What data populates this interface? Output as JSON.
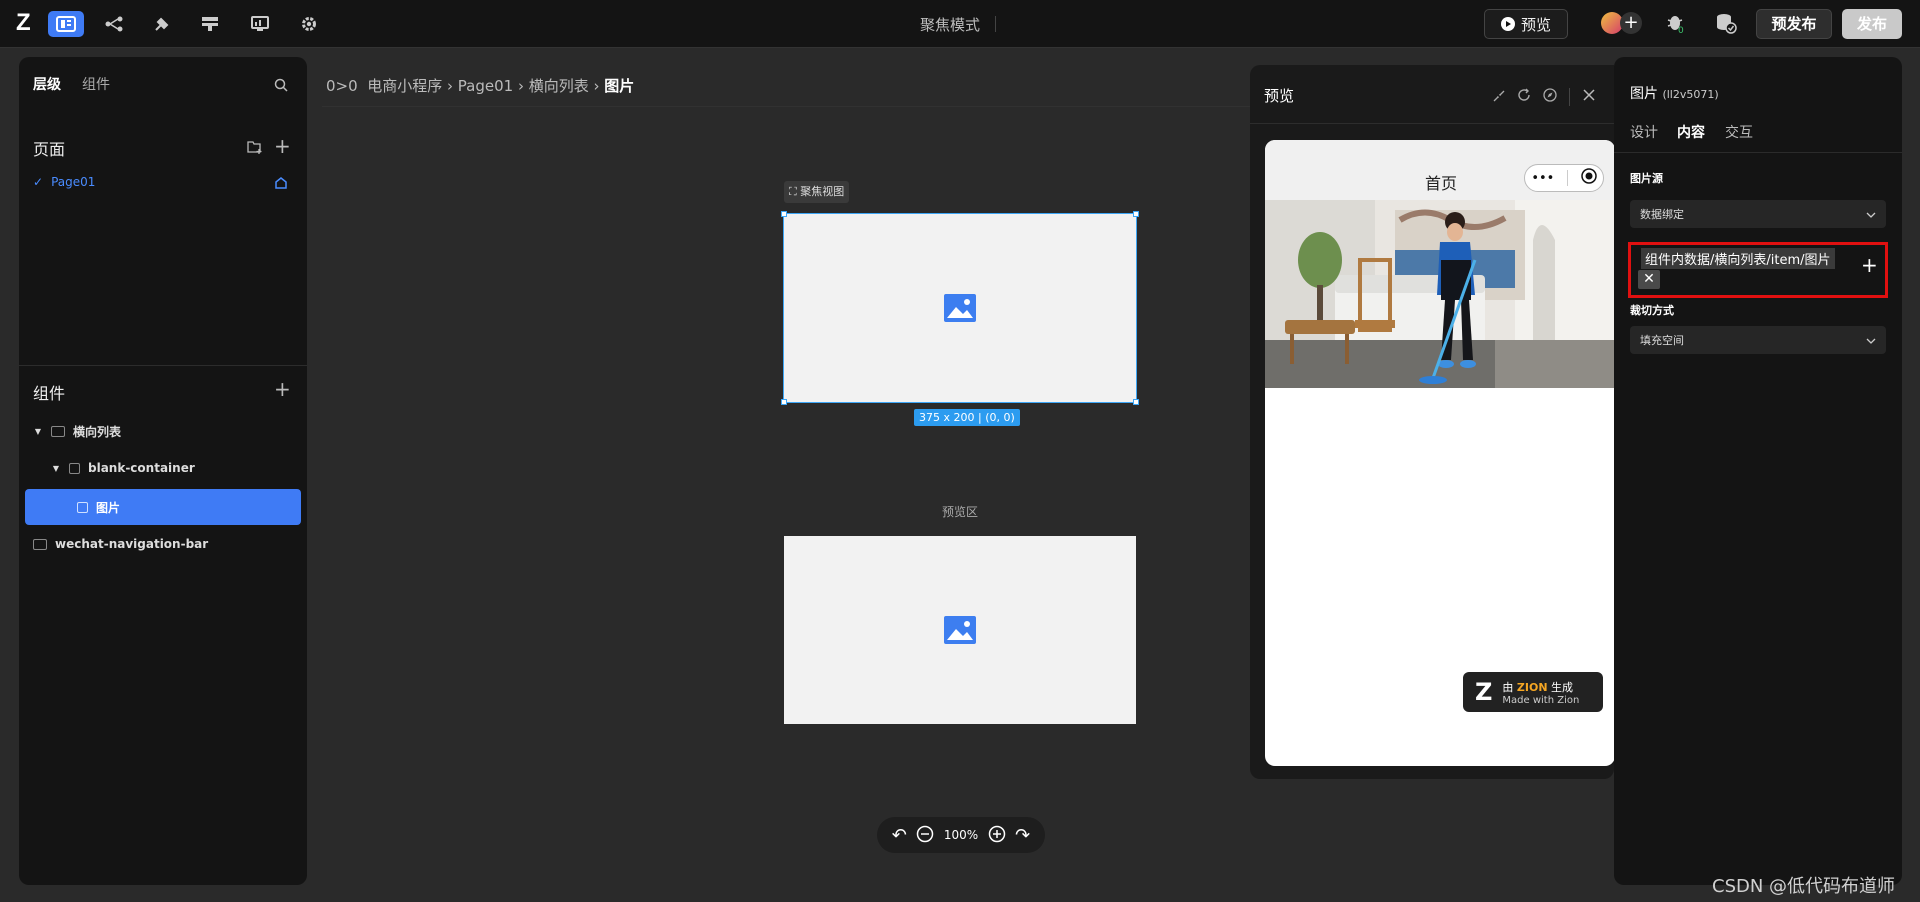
{
  "topbar": {
    "mode_title": "聚焦模式",
    "preview_label": "预览",
    "prepublish_label": "预发布",
    "publish_label": "发布"
  },
  "left_panel": {
    "tabs": [
      "层级",
      "组件"
    ],
    "pages_title": "页面",
    "pages": [
      "Page01"
    ],
    "components_title": "组件",
    "tree": [
      {
        "label": "横向列表",
        "depth": 0
      },
      {
        "label": "blank-container",
        "depth": 1
      },
      {
        "label": "图片",
        "depth": 2,
        "selected": true
      },
      {
        "label": "wechat-navigation-bar",
        "depth": 0
      }
    ]
  },
  "breadcrumb": {
    "root": "0>0",
    "items": [
      "电商小程序",
      "Page01",
      "横向列表"
    ],
    "current": "图片"
  },
  "canvas": {
    "focus_view_label": "聚焦视图",
    "size_tag": "375 x 200 | (0, 0)",
    "preview_area_label": "预览区",
    "zoom": "100%"
  },
  "preview": {
    "title": "预览",
    "phone_title": "首页",
    "capsule_dots": "•••",
    "badge_by": "由",
    "badge_brand": "ZION",
    "badge_gen": "生成",
    "badge_sub": "Made with Zion"
  },
  "right_panel": {
    "title": "图片",
    "id": "(ll2v5071)",
    "tabs": [
      "设计",
      "内容",
      "交互"
    ],
    "image_source_label": "图片源",
    "image_source_value": "数据绑定",
    "binding_value": "组件内数据/横向列表/item/图片",
    "crop_label": "裁切方式",
    "crop_value": "填充空间"
  },
  "watermark": "CSDN @低代码布道师",
  "colors": {
    "accent": "#3f7bf5",
    "highlight": "#e01010",
    "selection": "#3ea7f7"
  }
}
